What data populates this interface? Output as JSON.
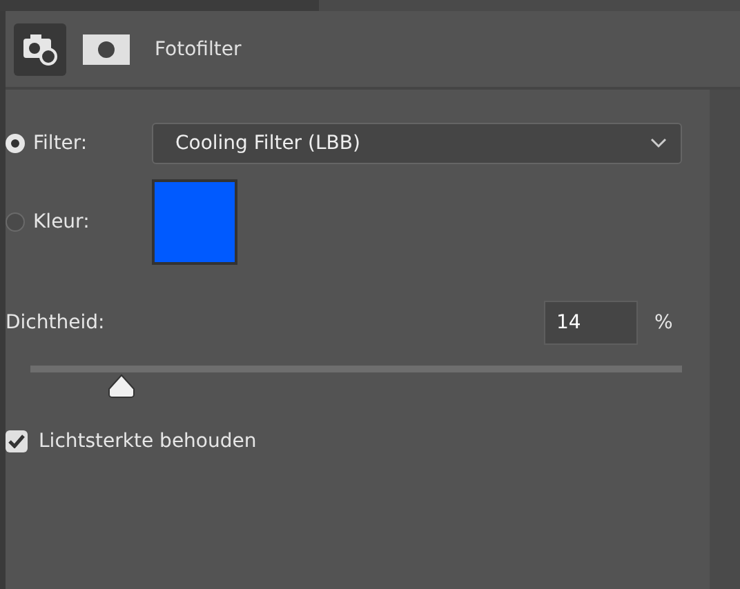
{
  "header": {
    "title": "Fotofilter",
    "tabs": [
      {
        "kind": "adjustment",
        "selected": true
      },
      {
        "kind": "mask",
        "selected": false
      }
    ]
  },
  "options": [
    {
      "kind": "filter",
      "label": "Filter:",
      "selected": true,
      "value": "Cooling Filter (LBB)"
    },
    {
      "kind": "color",
      "label": "Kleur:",
      "selected": false,
      "color": "#005aff"
    }
  ],
  "density": {
    "label": "Dichtheid:",
    "value": "14",
    "unit": "%",
    "level": 0.14
  },
  "preserve": {
    "label": "Lichtsterkte behouden",
    "checked": true
  }
}
